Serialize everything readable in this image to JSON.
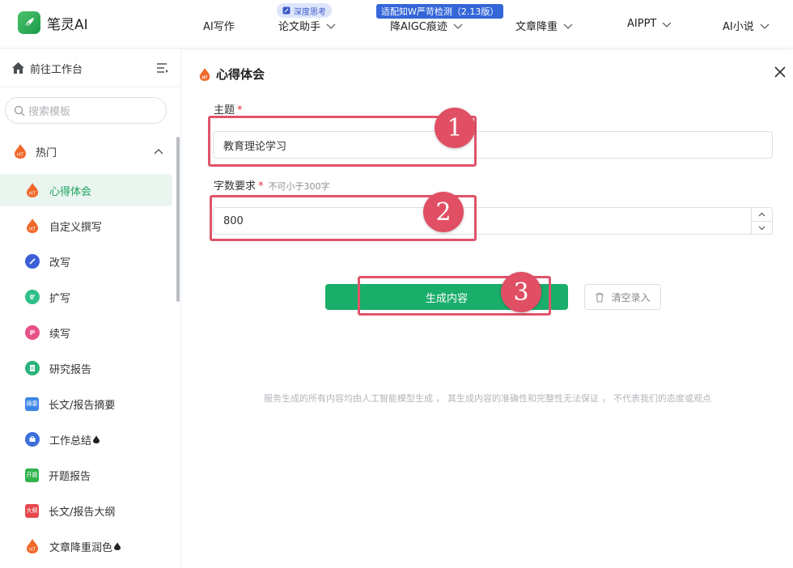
{
  "brand": {
    "name": "笔灵AI"
  },
  "nav": {
    "items": [
      {
        "label": "AI写作",
        "has_dropdown": false
      },
      {
        "label": "论文助手",
        "has_dropdown": true,
        "badge": "深度思考"
      },
      {
        "label": "降AIGC痕迹",
        "has_dropdown": true,
        "badge": "适配知W严苛检测（2.13版）"
      },
      {
        "label": "文章降重",
        "has_dropdown": true
      },
      {
        "label": "AIPPT",
        "has_dropdown": true
      },
      {
        "label": "AI小说",
        "has_dropdown": true
      }
    ]
  },
  "sidebar": {
    "workspace_label": "前往工作台",
    "search_placeholder": "搜索模板",
    "group_label": "热门",
    "items": [
      {
        "label": "心得体会",
        "icon": "fire-ht-icon",
        "active": true
      },
      {
        "label": "自定义撰写",
        "icon": "fire-ht-icon"
      },
      {
        "label": "改写",
        "icon": "pen-circle-icon"
      },
      {
        "label": "扩写",
        "icon": "expand-circle-icon"
      },
      {
        "label": "续写",
        "icon": "continue-circle-icon"
      },
      {
        "label": "研究报告",
        "icon": "document-circle-icon"
      },
      {
        "label": "长文/报告摘要",
        "icon": "summary-tag-icon",
        "tag": "摘要"
      },
      {
        "label": "工作总结",
        "icon": "briefcase-circle-icon",
        "drop": true
      },
      {
        "label": "开题报告",
        "icon": "opening-tag-icon",
        "tag": "开题"
      },
      {
        "label": "长文/报告大纲",
        "icon": "outline-tag-icon",
        "tag": "大纲"
      },
      {
        "label": "文章降重润色",
        "icon": "fire-ht-icon",
        "drop": true
      }
    ]
  },
  "main": {
    "title": "心得体会",
    "topic_label": "主题",
    "topic_value": "教育理论学习",
    "word_label": "字数要求",
    "word_hint": "不可小于300字",
    "word_value": "800",
    "generate_label": "生成内容",
    "clear_label": "清空录入",
    "disclaimer": "服务生成的所有内容均由人工智能模型生成 ， 其生成内容的准确性和完整性无法保证 ， 不代表我们的态度或观点"
  },
  "annotations": [
    "1",
    "2",
    "3"
  ],
  "colors": {
    "accent": "#1aae6b",
    "annotation": "#e04f64",
    "nav_badge": "#3466d8"
  }
}
